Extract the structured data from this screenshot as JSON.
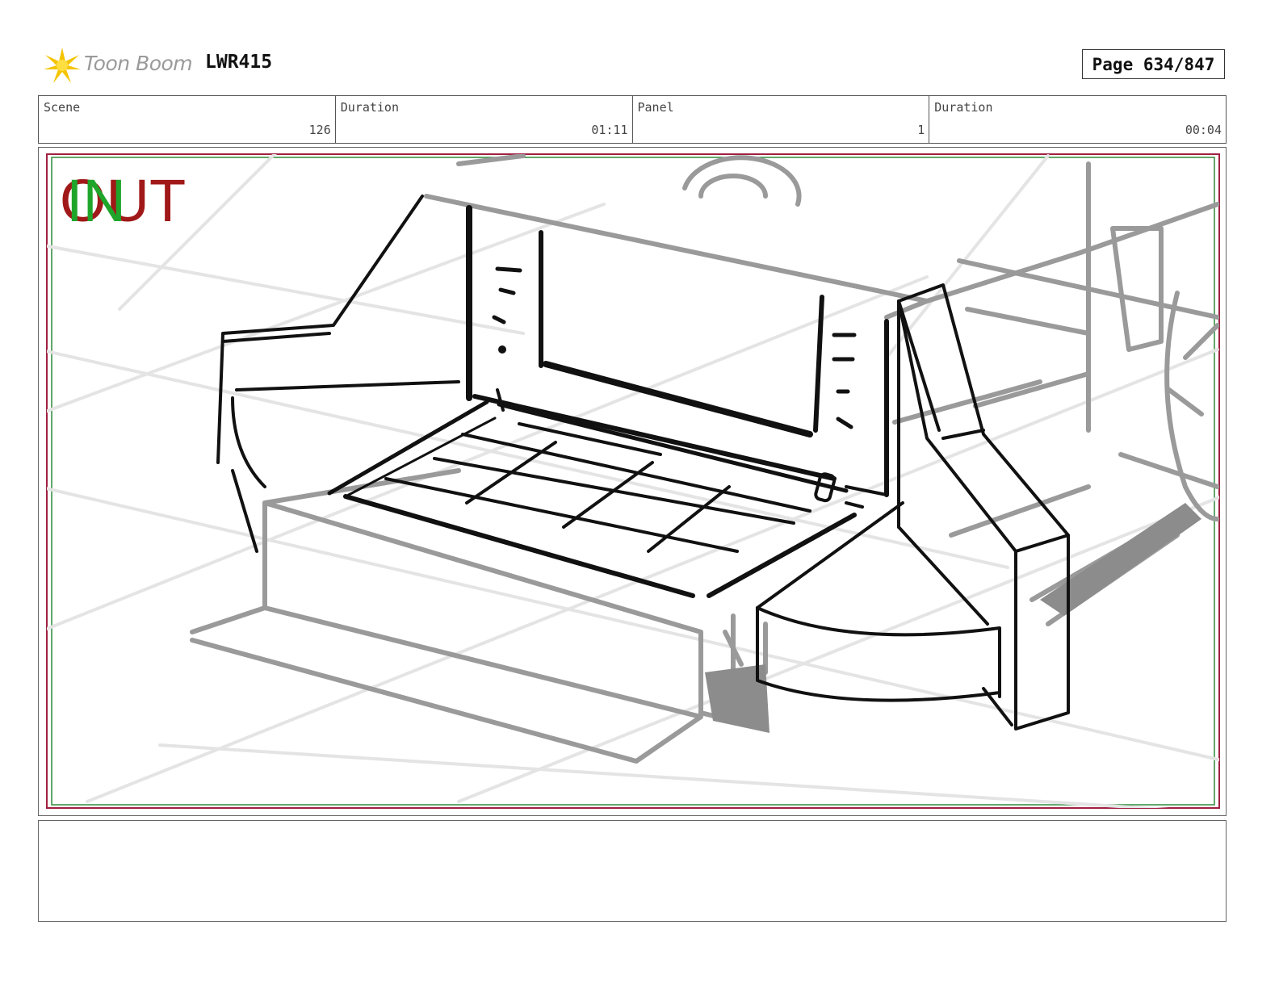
{
  "header": {
    "logo_text": "Toon Boom",
    "project_code": "LWR415",
    "page_label": "Page 634/847"
  },
  "info": [
    {
      "label": "Scene",
      "value": "126"
    },
    {
      "label": "Duration",
      "value": "01:11"
    },
    {
      "label": "Panel",
      "value": "1"
    },
    {
      "label": "Duration",
      "value": "00:04"
    }
  ],
  "panel": {
    "out_mark": "OUT",
    "in_mark": "IN",
    "out_color": "#a01818",
    "in_color": "#1fa52a"
  },
  "notes": {
    "text": ""
  }
}
